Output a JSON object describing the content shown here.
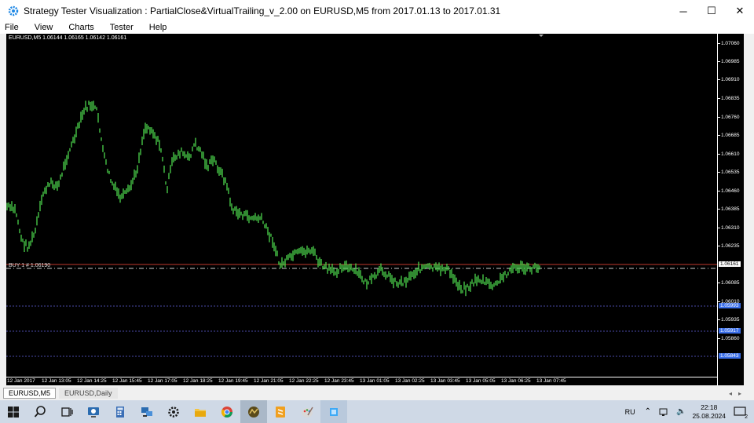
{
  "window": {
    "title": "Strategy Tester Visualization : PartialClose&VirtualTrailing_v_2.00 on EURUSD,M5 from 2017.01.13 to 2017.01.31",
    "controls": {
      "minimize": "─",
      "maximize": "☐",
      "close": "✕"
    }
  },
  "menu": [
    "File",
    "View",
    "Charts",
    "Tester",
    "Help"
  ],
  "chart": {
    "info": "EURUSD,M5  1.06144 1.06165 1.06142 1.06161",
    "buy_label": "BUY 1 # 1.06190",
    "colors": {
      "background": "#000000",
      "candle": "#4cd44c",
      "bid_line": "#c0392b",
      "order_line": "#3a6ee8",
      "level": "#4a4aa8"
    },
    "price_ticks": [
      "1.07060",
      "1.06985",
      "1.06910",
      "1.06835",
      "1.06760",
      "1.06685",
      "1.06610",
      "1.06535",
      "1.06460",
      "1.06385",
      "1.06310",
      "1.06235",
      "1.06085",
      "1.06010",
      "1.05935",
      "1.05860"
    ],
    "price_tags": {
      "current": "1.06161",
      "level1": "1.05993",
      "level2": "1.05917",
      "level3": "1.05843"
    },
    "time_labels": [
      "12 Jan 2017",
      "12 Jan 13:05",
      "12 Jan 14:25",
      "12 Jan 15:45",
      "12 Jan 17:05",
      "12 Jan 18:25",
      "12 Jan 19:45",
      "12 Jan 21:05",
      "12 Jan 22:25",
      "12 Jan 23:45",
      "13 Jan 01:05",
      "13 Jan 02:25",
      "13 Jan 03:45",
      "13 Jan 05:05",
      "13 Jan 06:25",
      "13 Jan 07:45"
    ]
  },
  "tabs": [
    {
      "label": "EURUSD,M5",
      "active": true
    },
    {
      "label": "EURUSD,Daily",
      "active": false
    }
  ],
  "taskbar": {
    "icons": [
      "windows-start-icon",
      "search-icon",
      "task-view-icon",
      "remote-desktop-icon",
      "calculator-icon",
      "network-icon",
      "settings-gear-icon",
      "file-explorer-icon",
      "chrome-icon",
      "metatrader-icon",
      "sublime-icon",
      "paint-icon",
      "app-square-icon"
    ],
    "language": "RU",
    "time": "22:18",
    "date": "25.08.2024",
    "notifications": "2"
  }
}
